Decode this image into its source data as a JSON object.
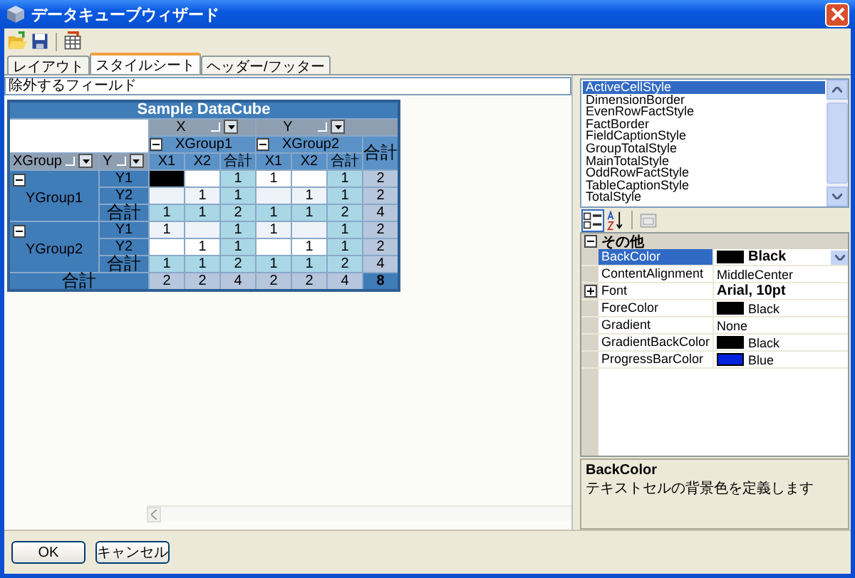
{
  "window": {
    "title": "データキューブウィザード"
  },
  "tabs": [
    {
      "label": "レイアウト",
      "selected": false
    },
    {
      "label": "スタイルシート",
      "selected": true
    },
    {
      "label": "ヘッダー/フッター",
      "selected": false
    }
  ],
  "excluded_fields": {
    "value": "除外するフィールド"
  },
  "cube": {
    "caption": "Sample DataCube",
    "column_fields": [
      {
        "label": "X"
      },
      {
        "label": "Y"
      }
    ],
    "row_fields": [
      {
        "label": "XGroup"
      },
      {
        "label": "Y"
      }
    ],
    "column_groups": [
      {
        "label": "XGroup1",
        "expanded": true,
        "columns": [
          {
            "label": "X1",
            "kind": "item"
          },
          {
            "label": "X2",
            "kind": "item"
          },
          {
            "label": "合計",
            "kind": "total"
          }
        ]
      },
      {
        "label": "XGroup2",
        "expanded": true,
        "columns": [
          {
            "label": "X1",
            "kind": "item"
          },
          {
            "label": "X2",
            "kind": "item"
          },
          {
            "label": "合計",
            "kind": "total"
          }
        ]
      }
    ],
    "grand_total_label": "合計",
    "row_groups": [
      {
        "label": "YGroup1",
        "expanded": true,
        "rows": [
          {
            "label": "Y1",
            "kind": "item",
            "cells": [
              {
                "selected": true
              },
              {
                "selected": false
              },
              {
                "value": "1",
                "selected": false
              },
              {
                "value": "1",
                "selected": false
              },
              {
                "selected": false
              },
              {
                "value": "1",
                "selected": false
              },
              {
                "value": "2",
                "selected": false
              }
            ]
          },
          {
            "label": "Y2",
            "kind": "item",
            "cells": [
              {
                "selected": false
              },
              {
                "value": "1",
                "selected": false
              },
              {
                "value": "1",
                "selected": false
              },
              {
                "selected": false
              },
              {
                "value": "1",
                "selected": false
              },
              {
                "value": "1",
                "selected": false
              },
              {
                "value": "2",
                "selected": false
              }
            ]
          },
          {
            "label": "合計",
            "kind": "total",
            "cells": [
              {
                "value": "1",
                "selected": false
              },
              {
                "value": "1",
                "selected": false
              },
              {
                "value": "2",
                "selected": false
              },
              {
                "value": "1",
                "selected": false
              },
              {
                "value": "1",
                "selected": false
              },
              {
                "value": "2",
                "selected": false
              },
              {
                "value": "4",
                "selected": false
              }
            ]
          }
        ]
      },
      {
        "label": "YGroup2",
        "expanded": true,
        "rows": [
          {
            "label": "Y1",
            "kind": "item",
            "cells": [
              {
                "value": "1",
                "selected": false
              },
              {
                "selected": false
              },
              {
                "value": "1",
                "selected": false
              },
              {
                "value": "1",
                "selected": false
              },
              {
                "selected": false
              },
              {
                "value": "1",
                "selected": false
              },
              {
                "value": "2",
                "selected": false
              }
            ]
          },
          {
            "label": "Y2",
            "kind": "item",
            "cells": [
              {
                "selected": false
              },
              {
                "value": "1",
                "selected": false
              },
              {
                "value": "1",
                "selected": false
              },
              {
                "selected": false
              },
              {
                "value": "1",
                "selected": false
              },
              {
                "value": "1",
                "selected": false
              },
              {
                "value": "2",
                "selected": false
              }
            ]
          },
          {
            "label": "合計",
            "kind": "total",
            "cells": [
              {
                "value": "1",
                "selected": false
              },
              {
                "value": "1",
                "selected": false
              },
              {
                "value": "2",
                "selected": false
              },
              {
                "value": "1",
                "selected": false
              },
              {
                "value": "1",
                "selected": false
              },
              {
                "value": "2",
                "selected": false
              },
              {
                "value": "4",
                "selected": false
              }
            ]
          }
        ]
      }
    ],
    "grand_total_row": {
      "label": "合計",
      "cells": [
        {
          "value": "2",
          "selected": false
        },
        {
          "value": "2",
          "selected": false
        },
        {
          "value": "4",
          "selected": false
        },
        {
          "value": "2",
          "selected": false
        },
        {
          "value": "2",
          "selected": false
        },
        {
          "value": "4",
          "selected": false
        },
        {
          "value": "8",
          "selected": false
        }
      ]
    }
  },
  "style_list": [
    {
      "label": "ActiveCellStyle",
      "selected": true
    },
    {
      "label": "DimensionBorder",
      "selected": false
    },
    {
      "label": "EvenRowFactStyle",
      "selected": false
    },
    {
      "label": "FactBorder",
      "selected": false
    },
    {
      "label": "FieldCaptionStyle",
      "selected": false
    },
    {
      "label": "GroupTotalStyle",
      "selected": false
    },
    {
      "label": "MainTotalStyle",
      "selected": false
    },
    {
      "label": "OddRowFactStyle",
      "selected": false
    },
    {
      "label": "TableCaptionStyle",
      "selected": false
    },
    {
      "label": "TotalStyle",
      "selected": false
    }
  ],
  "property_grid": {
    "category": "その他",
    "expanded": true,
    "properties": [
      {
        "name": "BackColor",
        "kind": "color",
        "color": "#000000",
        "value": "Black",
        "modified": true,
        "selected": true
      },
      {
        "name": "ContentAlignment",
        "kind": "plain",
        "value": "MiddleCenter",
        "modified": false,
        "selected": false
      },
      {
        "name": "Font",
        "kind": "expandable",
        "expanded": false,
        "value": "Arial, 10pt",
        "modified": true,
        "selected": false
      },
      {
        "name": "ForeColor",
        "kind": "color",
        "color": "#000000",
        "value": "Black",
        "modified": false,
        "selected": false
      },
      {
        "name": "Gradient",
        "kind": "plain",
        "value": "None",
        "modified": false,
        "selected": false
      },
      {
        "name": "GradientBackColor",
        "kind": "color",
        "color": "#000000",
        "value": "Black",
        "modified": false,
        "selected": false
      },
      {
        "name": "ProgressBarColor",
        "kind": "color",
        "color": "#0022dd",
        "value": "Blue",
        "modified": false,
        "selected": false
      }
    ]
  },
  "description": {
    "title": "BackColor",
    "text": "テキストセルの背景色を定義します"
  },
  "buttons": [
    {
      "label": "OK"
    },
    {
      "label": "キャンセル"
    }
  ]
}
